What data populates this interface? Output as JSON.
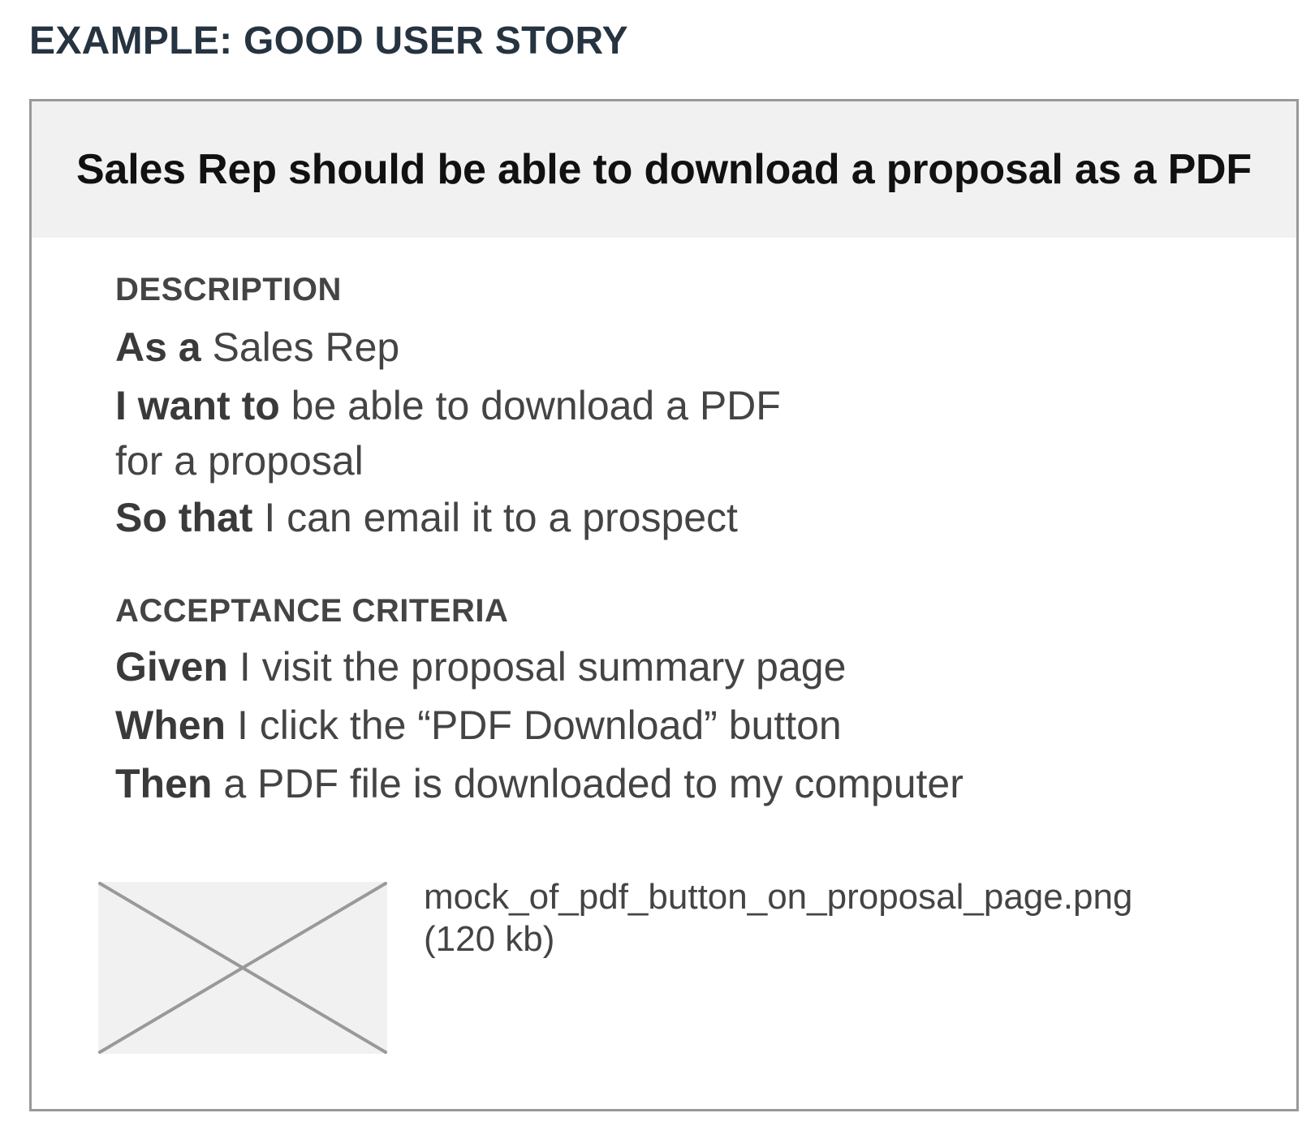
{
  "heading": "EXAMPLE: GOOD USER STORY",
  "story": {
    "title": "Sales Rep should be able to download a proposal as a PDF",
    "description": {
      "label": "DESCRIPTION",
      "as_a_keyword": "As a",
      "as_a_text": " Sales Rep",
      "i_want_to_keyword": "I want to",
      "i_want_to_text": " be able to download a PDF",
      "i_want_to_text_cont": "for a proposal",
      "so_that_keyword": "So that",
      "so_that_text": " I can email it to a prospect"
    },
    "acceptance_criteria": {
      "label": "ACCEPTANCE CRITERIA",
      "given_keyword": "Given",
      "given_text": " I visit the proposal summary page",
      "when_keyword": "When",
      "when_text": " I click the “PDF Download” button",
      "then_keyword": "Then",
      "then_text": " a PDF file is downloaded to my computer"
    },
    "attachment": {
      "filename": "mock_of_pdf_button_on_proposal_page.png",
      "size": "(120 kb)",
      "thumbnail_icon": "image-placeholder-icon"
    }
  },
  "colors": {
    "heading": "#263340",
    "title": "#111111",
    "body_text": "#444444",
    "card_border": "#999999",
    "header_background": "#f1f1f1",
    "placeholder_stroke": "#999999"
  }
}
